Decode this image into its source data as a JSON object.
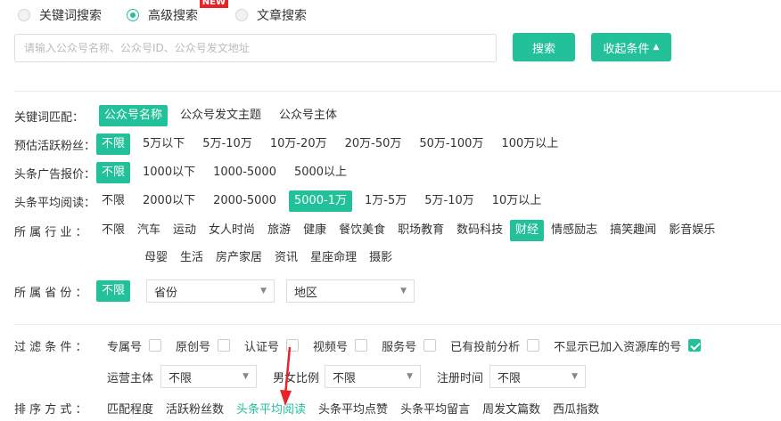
{
  "search_type": {
    "options": [
      {
        "label": "关键词搜索",
        "selected": false
      },
      {
        "label": "高级搜索",
        "selected": true,
        "badge": "NEW"
      },
      {
        "label": "文章搜索",
        "selected": false
      }
    ]
  },
  "search": {
    "placeholder": "请输入公众号名称、公众号ID、公众号发文地址",
    "value": "",
    "button": "搜索",
    "collapse_button": "收起条件",
    "collapse_icon": "▲"
  },
  "filters": {
    "keyword_match": {
      "label": "关键词匹配：",
      "options": [
        "公众号名称",
        "公众号发文主题",
        "公众号主体"
      ],
      "selected": 0
    },
    "fans": {
      "label": "预估活跃粉丝：",
      "options": [
        "不限",
        "5万以下",
        "5万-10万",
        "10万-20万",
        "20万-50万",
        "50万-100万",
        "100万以上"
      ],
      "selected": 0
    },
    "ad_price": {
      "label": "头条广告报价：",
      "options": [
        "不限",
        "1000以下",
        "1000-5000",
        "5000以上"
      ],
      "selected": 0
    },
    "avg_read": {
      "label": "头条平均阅读：",
      "options": [
        "不限",
        "2000以下",
        "2000-5000",
        "5000-1万",
        "1万-5万",
        "5万-10万",
        "10万以上"
      ],
      "selected": 3
    },
    "industry": {
      "label": "所 属 行 业 ：",
      "row1": [
        "不限",
        "汽车",
        "运动",
        "女人时尚",
        "旅游",
        "健康",
        "餐饮美食",
        "职场教育",
        "数码科技",
        "财经",
        "情感励志",
        "搞笑趣闻",
        "影音娱乐"
      ],
      "row2": [
        "母婴",
        "生活",
        "房产家居",
        "资讯",
        "星座命理",
        "摄影"
      ],
      "selected": "财经"
    },
    "province": {
      "label": "所 属 省 份 ：",
      "any": "不限",
      "province_select": "省份",
      "region_select": "地区"
    }
  },
  "filter_conditions": {
    "label": "过 滤 条 件 ：",
    "checks": [
      {
        "label": "专属号",
        "checked": false
      },
      {
        "label": "原创号",
        "checked": false
      },
      {
        "label": "认证号",
        "checked": false
      },
      {
        "label": "视频号",
        "checked": false
      },
      {
        "label": "服务号",
        "checked": false
      },
      {
        "label": "已有投前分析",
        "checked": false
      },
      {
        "label": "不显示已加入资源库的号",
        "checked": true
      }
    ],
    "operator": {
      "label": "运营主体",
      "value": "不限"
    },
    "gender": {
      "label": "男女比例",
      "value": "不限"
    },
    "reg_time": {
      "label": "注册时间",
      "value": "不限"
    }
  },
  "sort": {
    "label": "排 序 方 式 ：",
    "items": [
      "匹配程度",
      "活跃粉丝数",
      "头条平均阅读",
      "头条平均点赞",
      "头条平均留言",
      "周发文篇数",
      "西瓜指数"
    ],
    "active": 2
  },
  "colors": {
    "accent": "#23c19a",
    "badge": "#e8232a",
    "arrow": "#e8232a"
  }
}
